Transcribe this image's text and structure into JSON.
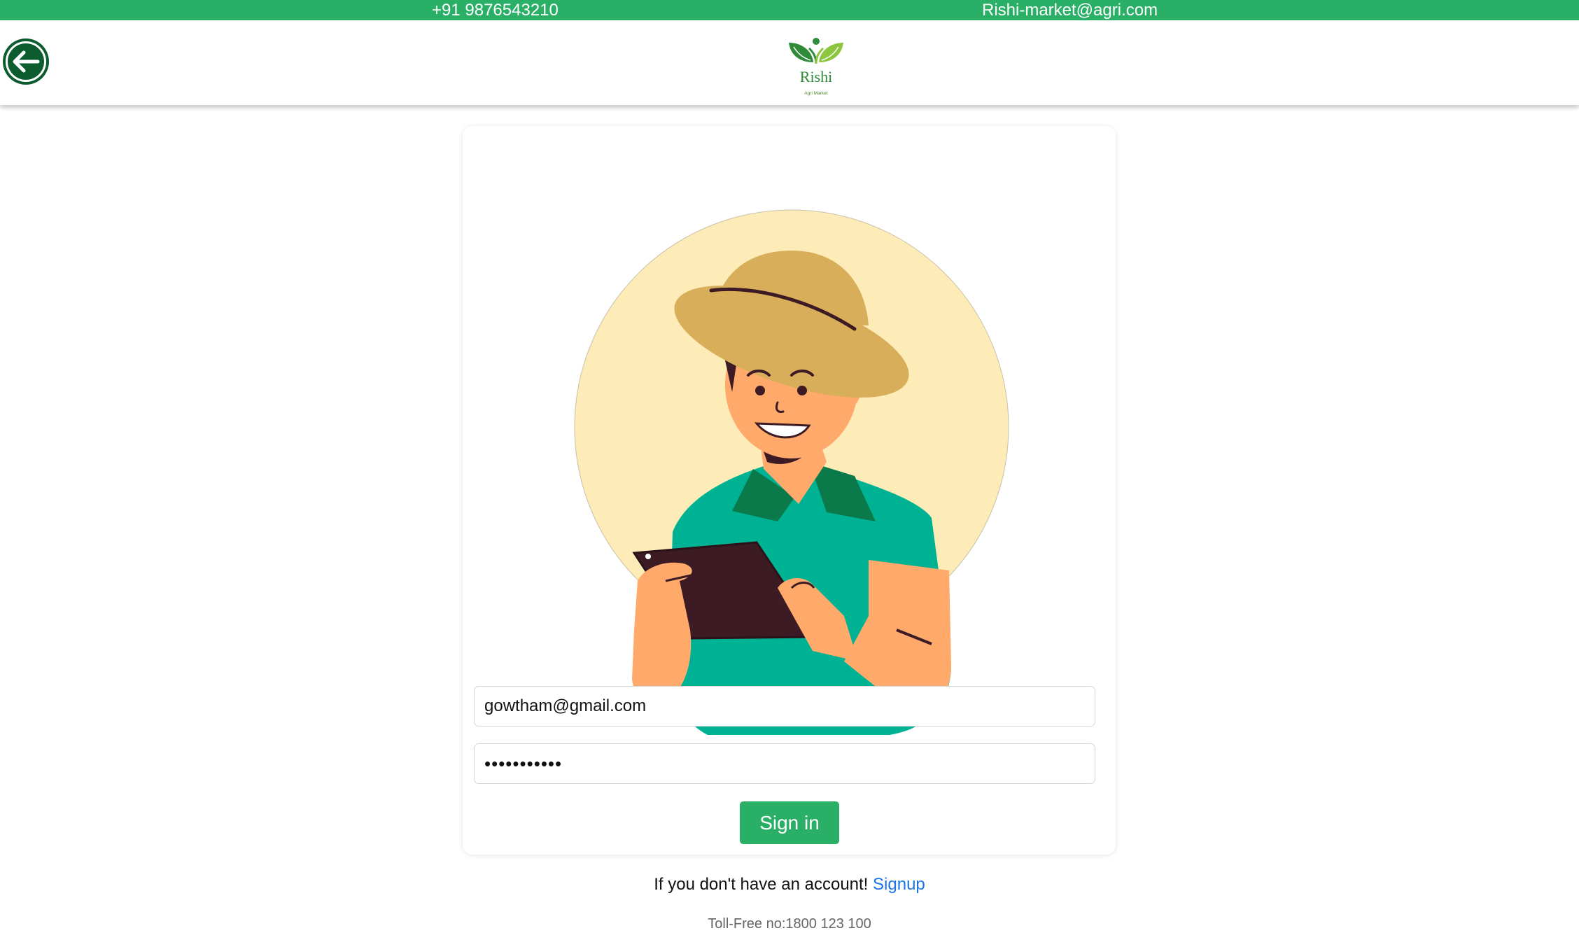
{
  "topbar": {
    "phone": "+91 9876543210",
    "email": "Rishi-market@agri.com",
    "background": "#2aaf67"
  },
  "header": {
    "back_icon": "arrow-left-circle-icon",
    "logo": {
      "name": "Rishi",
      "tagline": "Agri Market",
      "icon": "sprout-leaves-icon"
    }
  },
  "login": {
    "illustration": "farmer-with-tablet-illustration",
    "email_value": "gowtham@gmail.com",
    "email_placeholder": "",
    "password_value": "•••••••••••",
    "signin_label": "Sign in",
    "accent": "#2aaf67"
  },
  "footer": {
    "signup_prompt": "If you don't have an account!",
    "signup_link": "Signup",
    "tollfree": "Toll-Free no:1800 123 100",
    "link_color": "#1a73e8"
  }
}
